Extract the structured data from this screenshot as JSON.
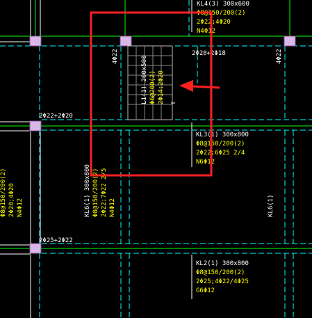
{
  "colors": {
    "background": "#000000",
    "axis": "#00ff00",
    "beam_dash": "#00ffff",
    "beam_solid": "#ffffff",
    "column": "#d8b8e8",
    "callout": "#ff2020",
    "text_white": "#ffffff",
    "text_yellow": "#ffff00"
  },
  "annotations": {
    "kl4": {
      "name": "KL4(3) 300x600",
      "stirrup": "Φ8@150/200(2)",
      "bars": "2Φ22;4Φ20",
      "side": "N4Φ12"
    },
    "top_bars": "2Φ20+2Φ18",
    "col_left": "4Φ22",
    "col_right": "4Φ22",
    "l1": {
      "name": "L1(1) 200x500",
      "stirrup": "Φ6@200(2)",
      "bars": "2Φ14;2Φ20"
    },
    "left_top_bars": "2Φ22+2Φ20",
    "kl3": {
      "name": "KL3(1) 300x800",
      "stirrup": "Φ8@150/200(2)",
      "bars": "2Φ22;6Φ25 2/4",
      "side": "N6Φ12"
    },
    "kl6": {
      "name": "KL6(1) 300x800",
      "stirrup": "Φ8@150/200(2)",
      "bars": "2Φ22;7Φ22 2/5",
      "side": "N4Φ12"
    },
    "far_left": {
      "stirrup": "Φ8@150/200(2)",
      "bars": "2Φ20;4Φ20",
      "side": "N4Φ12"
    },
    "kl6_right": "KL6(1)",
    "left_bottom_bars": "2Φ25+2Φ22",
    "kl2": {
      "name": "KL2(1) 300x800",
      "stirrup": "Φ8@150/200(2)",
      "bars": "2Φ25;4Φ22/4Φ25",
      "side": "G6Φ12"
    }
  }
}
